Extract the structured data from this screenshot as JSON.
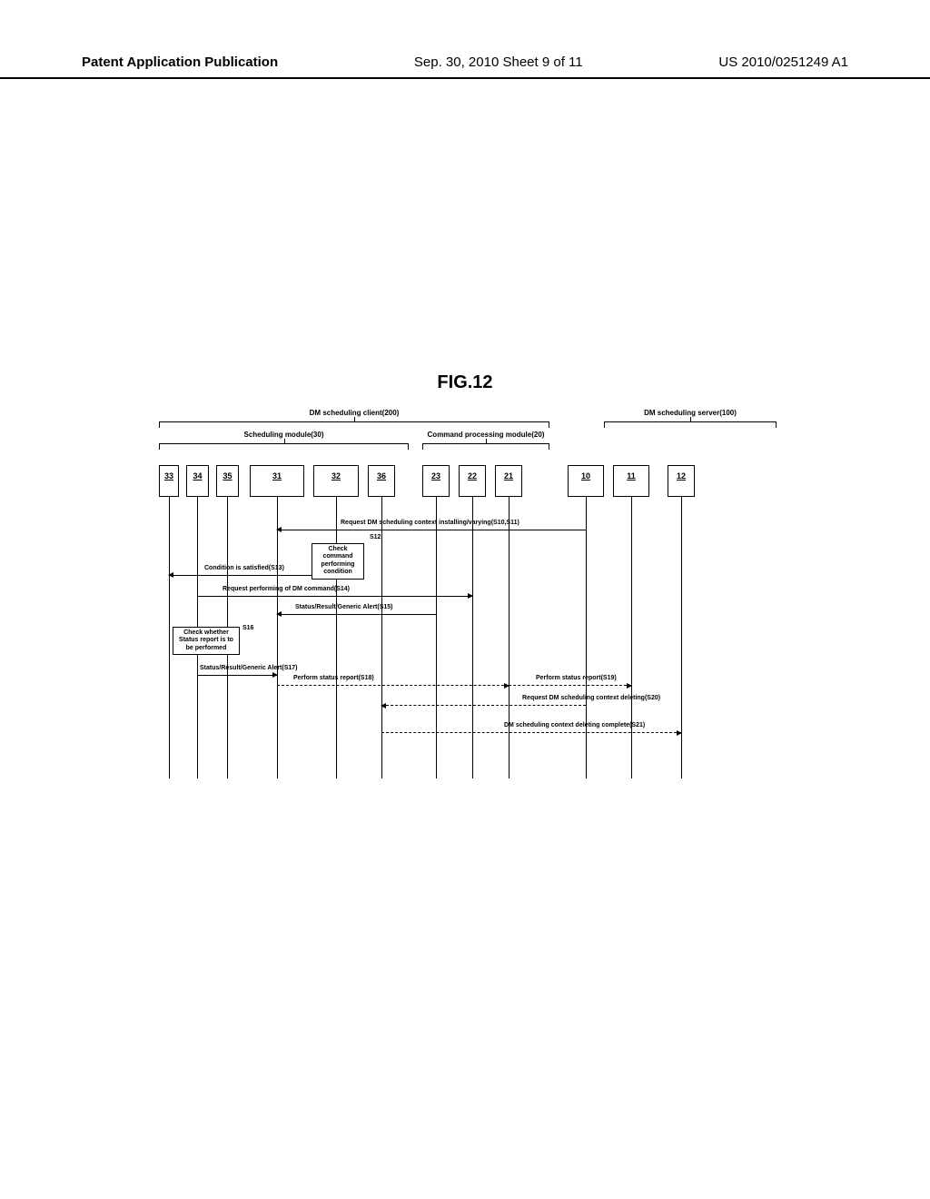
{
  "header": {
    "left": "Patent Application Publication",
    "center": "Sep. 30, 2010  Sheet 9 of 11",
    "right": "US 2010/0251249 A1"
  },
  "figure_title": "FIG.12",
  "braces": {
    "client": "DM scheduling client(200)",
    "server": "DM scheduling server(100)",
    "scheduling": "Scheduling module(30)",
    "command": "Command processing module(20)"
  },
  "columns": {
    "c33": "33",
    "c34": "34",
    "c35": "35",
    "c31": "31",
    "c32": "32",
    "c36": "36",
    "c23": "23",
    "c22": "22",
    "c21": "21",
    "c10": "10",
    "c11": "11",
    "c12": "12"
  },
  "steps": {
    "s10_11": "Request DM scheduling context installing/varying(S10,S11)",
    "s12": "S12",
    "s12_box": "Check command performing condition",
    "s13": "Condition is satisfied(S13)",
    "s14": "Request performing of DM command(S14)",
    "s15": "Status/Result/Generic Alert(S15)",
    "s16": "S16",
    "s16_box": "Check whether Status report is to be performed",
    "s17": "Status/Result/Generic Alert(S17)",
    "s18": "Perform status report(S18)",
    "s19": "Perform status report(S19)",
    "s20": "Request DM scheduling context deleting(S20)",
    "s21": "DM scheduling context deleting complete(S21)"
  }
}
